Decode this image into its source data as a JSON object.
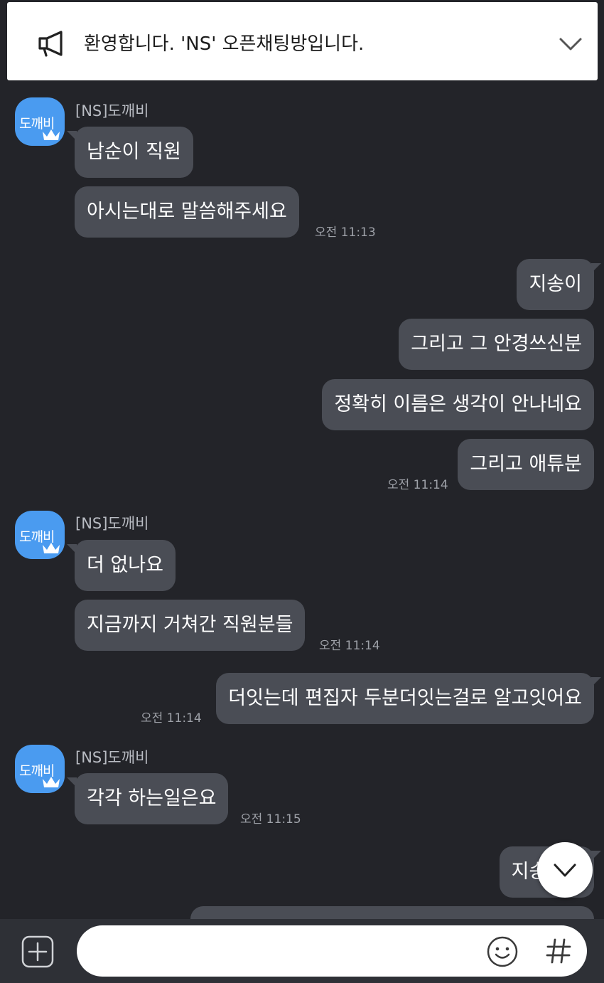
{
  "notice": {
    "icon": "megaphone-icon",
    "text": "환영합니다. 'NS' 오픈채팅방입니다.",
    "expand_icon": "chevron-down-icon"
  },
  "sender_avatar_label": "도깨비",
  "messages": {
    "g1_sender": "[NS]도깨비",
    "g1_b1": "남순이 직원",
    "g1_b2": "아시는대로 말씀해주세요",
    "g1_time": "오전 11:13",
    "me1_b1": "지송이",
    "me1_b2": "그리고 그 안경쓰신분",
    "me1_b3": "정확히 이름은 생각이 안나네요",
    "me1_b4": "그리고 애튜분",
    "me1_time": "오전 11:14",
    "g2_sender": "[NS]도깨비",
    "g2_b1": "더 없나요",
    "g2_b2": "지금까지 거쳐간 직원분들",
    "g2_time": "오전 11:14",
    "me2_b1": "더잇는데 편집자 두분더잇는걸로 알고잇어요",
    "me2_time": "오전 11:14",
    "g3_sender": "[NS]도깨비",
    "g3_b1": "각각 하는일은요",
    "g3_time": "오전 11:15",
    "me3_b1": "지송이는"
  },
  "input": {
    "placeholder": "",
    "plus_icon": "plus-square-icon",
    "emoji_icon": "smiley-icon",
    "hash_icon": "hash-icon"
  },
  "colors": {
    "background": "#232429",
    "bubble": "#4a4d55",
    "avatar": "#4a9bf0",
    "input_bar": "#2e3036"
  }
}
